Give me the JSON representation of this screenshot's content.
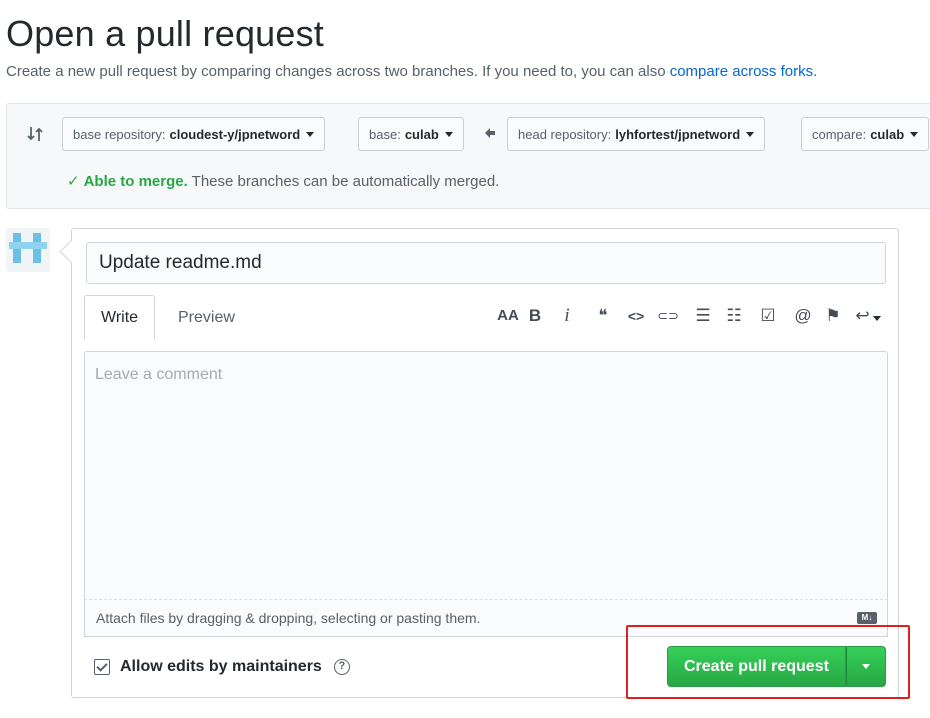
{
  "page": {
    "title": "Open a pull request",
    "subtitle_text": "Create a new pull request by comparing changes across two branches. If you need to, you can also ",
    "subtitle_link": "compare across forks."
  },
  "range": {
    "base_repo_prefix": "base repository:",
    "base_repo_value": "cloudest-y/jpnetword",
    "base_prefix": "base:",
    "base_value": "culab",
    "head_repo_prefix": "head repository:",
    "head_repo_value": "lyhfortest/jpnetword",
    "compare_prefix": "compare:",
    "compare_value": "culab",
    "merge_ok": "Able to merge.",
    "merge_text": " These branches can be automatically merged."
  },
  "editor": {
    "title_value": "Update readme.md",
    "tabs": [
      "Write",
      "Preview"
    ],
    "comment_placeholder": "Leave a comment",
    "attach_text": "Attach files by dragging & dropping, selecting or pasting them."
  },
  "toolbar": {
    "heading": "AA",
    "bold": "B",
    "italic": "i",
    "quote": "❝",
    "code": "<>",
    "link": "⊂⊃",
    "ul": "☰",
    "ol": "☷",
    "task": "☑",
    "mention": "@",
    "bookmark": "⚑",
    "reply": "↩"
  },
  "footer": {
    "allow_edits_label": "Allow edits by maintainers",
    "create_label": "Create pull request"
  },
  "colors": {
    "primary_green": "#28a745",
    "link_blue": "#0366d6",
    "highlight_red": "#e02020"
  }
}
